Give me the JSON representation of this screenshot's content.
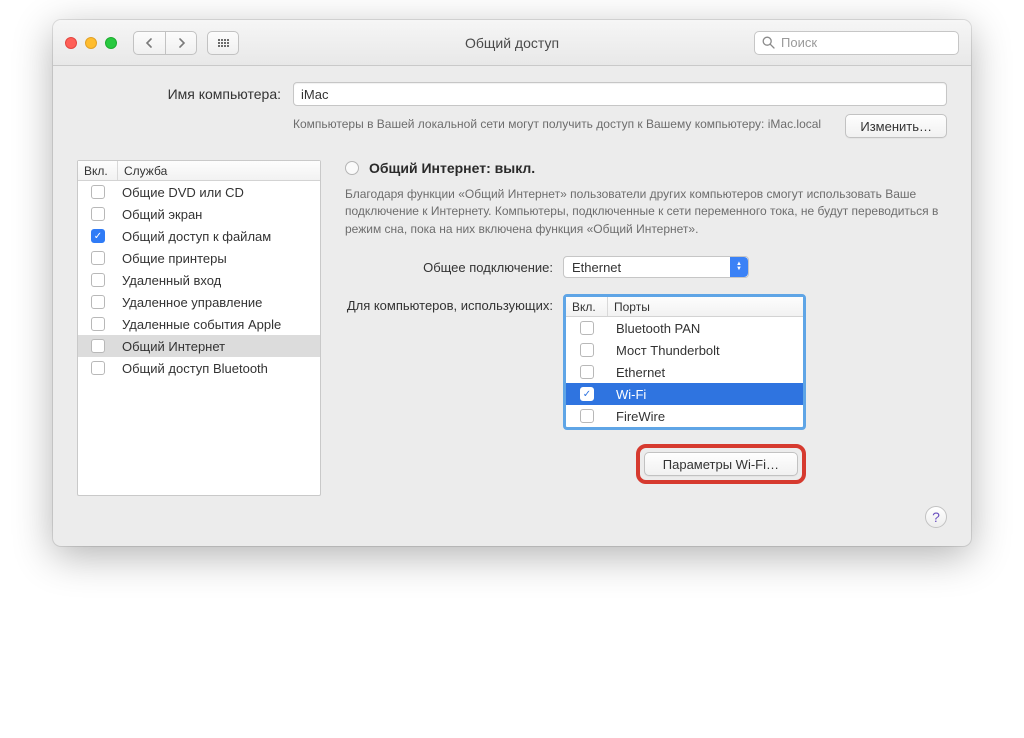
{
  "window": {
    "title": "Общий доступ"
  },
  "search": {
    "placeholder": "Поиск"
  },
  "name": {
    "label": "Имя компьютера:",
    "value": "iMac",
    "description": "Компьютеры в Вашей локальной сети могут получить доступ к Вашему компьютеру: iMac.local",
    "change_button": "Изменить…"
  },
  "services": {
    "col_on": "Вкл.",
    "col_service": "Служба",
    "items": [
      {
        "checked": false,
        "label": "Общие DVD или CD"
      },
      {
        "checked": false,
        "label": "Общий экран"
      },
      {
        "checked": true,
        "label": "Общий доступ к файлам"
      },
      {
        "checked": false,
        "label": "Общие принтеры"
      },
      {
        "checked": false,
        "label": "Удаленный вход"
      },
      {
        "checked": false,
        "label": "Удаленное управление"
      },
      {
        "checked": false,
        "label": "Удаленные события Apple"
      },
      {
        "checked": false,
        "label": "Общий Интернет",
        "selected": true
      },
      {
        "checked": false,
        "label": "Общий доступ Bluetooth"
      }
    ]
  },
  "detail": {
    "title": "Общий Интернет: выкл.",
    "description": "Благодаря функции «Общий Интернет» пользователи других компьютеров смогут использовать Ваше подключение к Интернету. Компьютеры, подключенные к сети переменного тока, не будут переводиться в режим сна, пока на них включена функция «Общий Интернет».",
    "connection_label": "Общее подключение:",
    "connection_value": "Ethernet",
    "ports_label": "Для компьютеров, использующих:",
    "ports": {
      "col_on": "Вкл.",
      "col_ports": "Порты",
      "items": [
        {
          "checked": false,
          "label": "Bluetooth PAN"
        },
        {
          "checked": false,
          "label": "Мост Thunderbolt"
        },
        {
          "checked": false,
          "label": "Ethernet"
        },
        {
          "checked": true,
          "label": "Wi-Fi",
          "selected": true
        },
        {
          "checked": false,
          "label": "FireWire"
        }
      ]
    },
    "wifi_options_button": "Параметры Wi-Fi…"
  },
  "help_glyph": "?"
}
